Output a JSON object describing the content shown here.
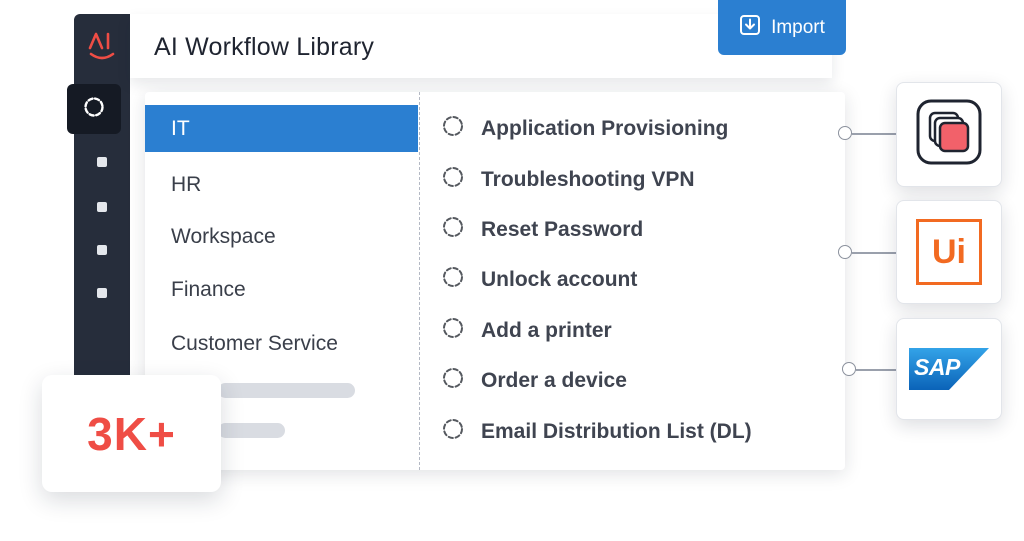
{
  "header": {
    "title": "AI Workflow Library",
    "import_label": "Import"
  },
  "sidebar": {
    "logo_text": "AI",
    "items": [
      "item-1",
      "item-2",
      "item-3",
      "item-4"
    ]
  },
  "categories": [
    {
      "label": "IT",
      "active": true
    },
    {
      "label": "HR",
      "active": false
    },
    {
      "label": "Workspace",
      "active": false
    },
    {
      "label": "Finance",
      "active": false
    },
    {
      "label": "Customer Service",
      "active": false
    }
  ],
  "workflows": [
    "Application Provisioning",
    "Troubleshooting VPN",
    "Reset Password",
    "Unlock account",
    "Add a printer",
    "Order a device",
    "Email Distribution List (DL)"
  ],
  "badge": {
    "value": "3K+"
  },
  "integrations": [
    {
      "name": "stack-app-icon"
    },
    {
      "name": "uipath-logo",
      "text": "Ui"
    },
    {
      "name": "sap-logo",
      "text": "SAP"
    }
  ],
  "colors": {
    "accent": "#2b7fd1",
    "sidebar": "#262d3b",
    "badge": "#ef4d45",
    "uipath": "#f26a21",
    "sap": "#1a7fd6"
  }
}
